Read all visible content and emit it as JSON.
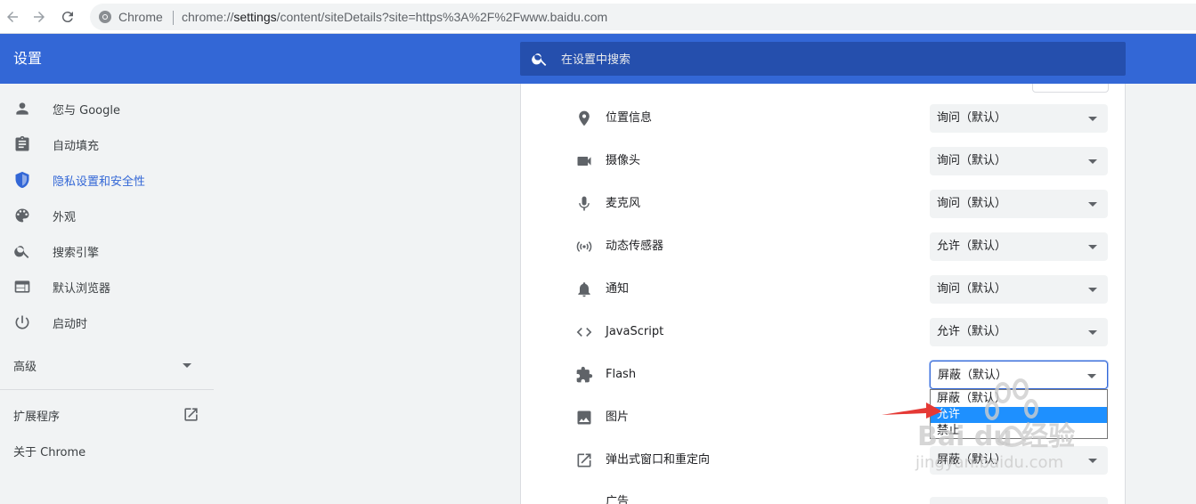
{
  "browser": {
    "chip_label": "Chrome",
    "url_prefix": "chrome://",
    "url_host": "settings",
    "url_rest": "/content/siteDetails?site=https%3A%2F%2Fwww.baidu.com"
  },
  "header": {
    "title": "设置",
    "search_placeholder": "在设置中搜索"
  },
  "sidebar": {
    "items": [
      {
        "label": "您与 Google",
        "icon": "person-icon"
      },
      {
        "label": "自动填充",
        "icon": "clipboard-icon"
      },
      {
        "label": "隐私设置和安全性",
        "icon": "shield-icon",
        "active": true
      },
      {
        "label": "外观",
        "icon": "palette-icon"
      },
      {
        "label": "搜索引擎",
        "icon": "search-icon"
      },
      {
        "label": "默认浏览器",
        "icon": "browser-window-icon"
      },
      {
        "label": "启动时",
        "icon": "power-icon"
      }
    ],
    "advanced_label": "高级",
    "extensions_label": "扩展程序",
    "about_label": "关于 Chrome"
  },
  "permissions": [
    {
      "label": "位置信息",
      "icon": "location-pin-icon",
      "value": "询问（默认）"
    },
    {
      "label": "摄像头",
      "icon": "camera-icon",
      "value": "询问（默认）"
    },
    {
      "label": "麦克风",
      "icon": "microphone-icon",
      "value": "询问（默认）"
    },
    {
      "label": "动态传感器",
      "icon": "sensor-icon",
      "value": "允许（默认）"
    },
    {
      "label": "通知",
      "icon": "bell-icon",
      "value": "询问（默认）"
    },
    {
      "label": "JavaScript",
      "icon": "code-icon",
      "value": "允许（默认）"
    },
    {
      "label": "Flash",
      "icon": "puzzle-icon",
      "value": "屏蔽（默认）"
    },
    {
      "label": "图片",
      "icon": "image-icon",
      "value": ""
    },
    {
      "label": "弹出式窗口和重定向",
      "icon": "open-in-new-icon",
      "value": "屏蔽（默认）"
    },
    {
      "label": "广告",
      "icon": "",
      "value": ""
    }
  ],
  "dropdown": {
    "options": [
      "屏蔽（默认）",
      "允许",
      "禁止"
    ],
    "highlighted_index": 1
  },
  "watermark": {
    "brand": "Bai du 经验",
    "site": "jingyan.baidu.com"
  },
  "colors": {
    "accent": "#3367d6",
    "header_search": "#254fad",
    "dropdown_highlight": "#1e90ff",
    "arrow": "#e53935"
  }
}
